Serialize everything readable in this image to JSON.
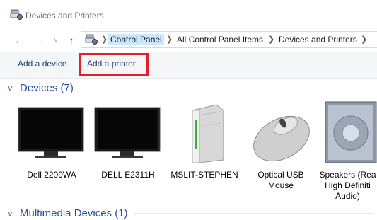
{
  "window": {
    "title": "Devices and Printers"
  },
  "nav": {
    "back_icon": "back-arrow-icon",
    "forward_icon": "forward-arrow-icon",
    "dropdown_icon": "chevron-down-icon",
    "up_icon": "up-arrow-icon"
  },
  "address": {
    "crumbs": [
      "Control Panel",
      "All Control Panel Items",
      "Devices and Printers"
    ]
  },
  "commands": {
    "add_device": "Add a device",
    "add_printer": "Add a printer"
  },
  "groups": {
    "devices": {
      "title": "Devices (7)"
    },
    "multimedia": {
      "title": "Multimedia Devices (1)"
    }
  },
  "devices": [
    {
      "label": "Dell 2209WA",
      "icon": "monitor-icon"
    },
    {
      "label": "DELL E2311H",
      "icon": "monitor-icon"
    },
    {
      "label": "MSLIT-STEPHEN",
      "icon": "computer-tower-icon"
    },
    {
      "label": "Optical USB\nMouse",
      "icon": "mouse-icon"
    },
    {
      "label": "Speakers (Rea\nHigh Definiti\nAudio)",
      "icon": "speaker-icon"
    }
  ],
  "colors": {
    "accent_red": "#e0202a",
    "link_blue": "#1e4fa0",
    "crumb_highlight": "#cce8ff"
  }
}
